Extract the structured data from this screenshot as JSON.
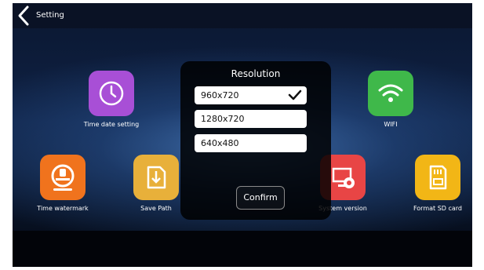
{
  "header": {
    "title": "Setting"
  },
  "apps": [
    {
      "label": "Time date setting",
      "color": "#a84fd6",
      "icon": "clock-icon"
    },
    {
      "label": "WIFI",
      "color": "#3fb84a",
      "icon": "wifi-icon"
    },
    {
      "label": "Time watermark",
      "color": "#f0731d",
      "icon": "stamp-icon"
    },
    {
      "label": "Save Path",
      "color": "#e8b03a",
      "icon": "folder-download-icon"
    },
    {
      "label": "System version",
      "color": "#e84545",
      "icon": "system-info-icon"
    },
    {
      "label": "Format SD card",
      "color": "#f2b616",
      "icon": "sd-card-icon"
    }
  ],
  "dialog": {
    "title": "Resolution",
    "options": [
      "960x720",
      "1280x720",
      "640x480"
    ],
    "selected": "960x720",
    "confirm_label": "Confirm"
  }
}
